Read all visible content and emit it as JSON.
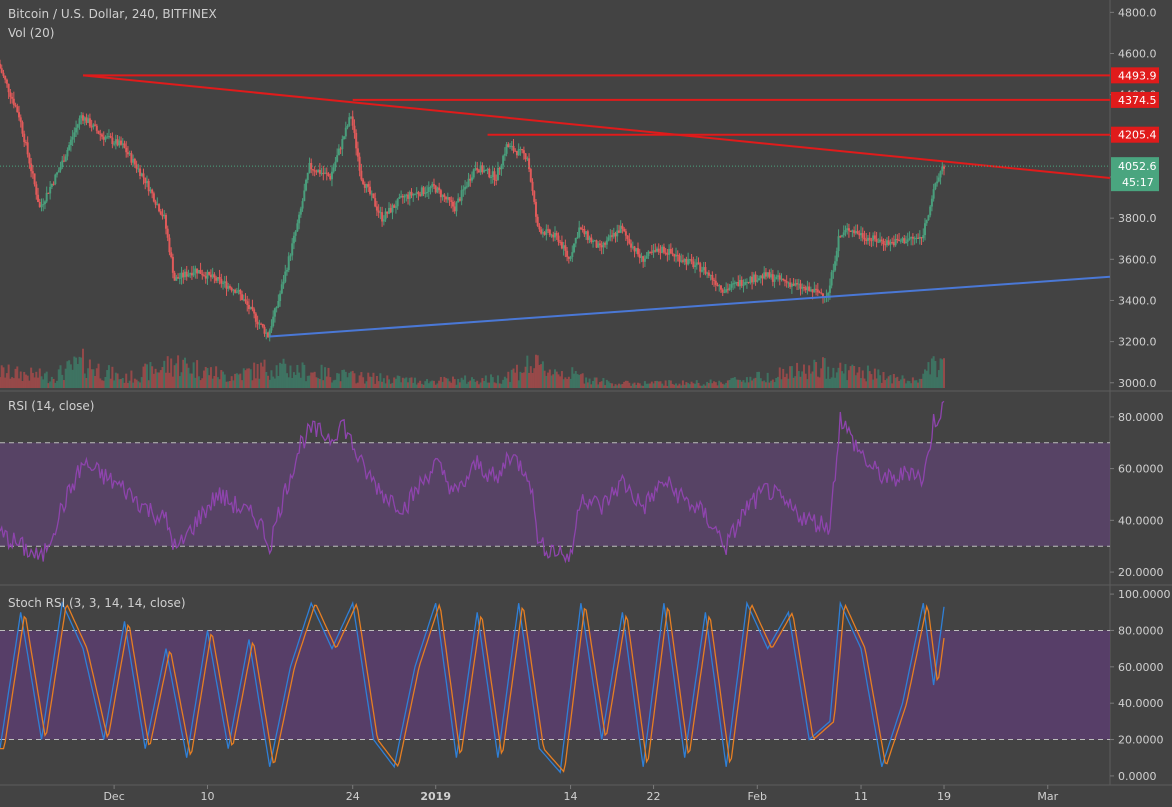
{
  "chart_data": [
    {
      "type": "candlestick",
      "title": "Bitcoin / U.S. Dollar, 240, BITFINEX",
      "volume_label": "Vol (20)",
      "ylim": [
        2960,
        4860
      ],
      "y_ticks": [
        "4800.0",
        "4600.0",
        "4400.0",
        "4200.0",
        "4000.0",
        "3800.0",
        "3600.0",
        "3400.0",
        "3200.0",
        "3000.0"
      ],
      "x_ticks": [
        "Dec",
        "10",
        "24",
        "2019",
        "14",
        "22",
        "Feb",
        "11",
        "19",
        "Mar"
      ],
      "x_start": "2018-11-20",
      "x_end": "2019-03-07",
      "last_price": "4052.6",
      "countdown": "45:17",
      "price_levels": [
        {
          "label": "4493.9",
          "value": 4493.9,
          "from": "2018-11-28"
        },
        {
          "label": "4374.5",
          "value": 4374.5,
          "from": "2018-12-24"
        },
        {
          "label": "4205.4",
          "value": 4205.4,
          "from": "2019-01-06"
        }
      ],
      "trendlines": [
        {
          "name": "resistance",
          "from": {
            "date": "2018-11-28",
            "price": 4493.9
          },
          "to": {
            "date": "2019-03-07",
            "price": 3995
          }
        },
        {
          "name": "support",
          "from": {
            "date": "2018-12-16",
            "price": 3225
          },
          "to": {
            "date": "2019-03-07",
            "price": 3515
          }
        }
      ],
      "price_path": [
        [
          "2018-11-20",
          4550
        ],
        [
          "2018-11-22",
          4300
        ],
        [
          "2018-11-24",
          3850
        ],
        [
          "2018-11-26",
          4050
        ],
        [
          "2018-11-28",
          4300
        ],
        [
          "2018-11-30",
          4200
        ],
        [
          "2018-12-02",
          4150
        ],
        [
          "2018-12-04",
          4000
        ],
        [
          "2018-12-06",
          3800
        ],
        [
          "2018-12-07",
          3500
        ],
        [
          "2018-12-09",
          3550
        ],
        [
          "2018-12-11",
          3500
        ],
        [
          "2018-12-13",
          3450
        ],
        [
          "2018-12-15",
          3300
        ],
        [
          "2018-12-16",
          3230
        ],
        [
          "2018-12-17",
          3400
        ],
        [
          "2018-12-19",
          3800
        ],
        [
          "2018-12-20",
          4050
        ],
        [
          "2018-12-22",
          4000
        ],
        [
          "2018-12-24",
          4300
        ],
        [
          "2018-12-25",
          4000
        ],
        [
          "2018-12-27",
          3800
        ],
        [
          "2018-12-29",
          3900
        ],
        [
          "2019-01-01",
          3950
        ],
        [
          "2019-01-03",
          3850
        ],
        [
          "2019-01-05",
          4050
        ],
        [
          "2019-01-07",
          4000
        ],
        [
          "2019-01-08",
          4150
        ],
        [
          "2019-01-10",
          4100
        ],
        [
          "2019-01-11",
          3750
        ],
        [
          "2019-01-13",
          3700
        ],
        [
          "2019-01-14",
          3600
        ],
        [
          "2019-01-15",
          3750
        ],
        [
          "2019-01-17",
          3650
        ],
        [
          "2019-01-19",
          3750
        ],
        [
          "2019-01-21",
          3600
        ],
        [
          "2019-01-23",
          3650
        ],
        [
          "2019-01-25",
          3600
        ],
        [
          "2019-01-27",
          3550
        ],
        [
          "2019-01-29",
          3450
        ],
        [
          "2019-01-31",
          3500
        ],
        [
          "2019-02-02",
          3520
        ],
        [
          "2019-02-04",
          3490
        ],
        [
          "2019-02-06",
          3450
        ],
        [
          "2019-02-08",
          3430
        ],
        [
          "2019-02-09",
          3700
        ],
        [
          "2019-02-10",
          3750
        ],
        [
          "2019-02-12",
          3700
        ],
        [
          "2019-02-14",
          3680
        ],
        [
          "2019-02-16",
          3700
        ],
        [
          "2019-02-17",
          3700
        ],
        [
          "2019-02-18",
          3900
        ],
        [
          "2019-02-19",
          4052.6
        ]
      ],
      "volume_path": [
        [
          "2018-11-20",
          0.35
        ],
        [
          "2018-11-25",
          0.25
        ],
        [
          "2018-11-28",
          0.55
        ],
        [
          "2018-12-02",
          0.2
        ],
        [
          "2018-12-07",
          0.55
        ],
        [
          "2018-12-12",
          0.25
        ],
        [
          "2018-12-16",
          0.45
        ],
        [
          "2018-12-20",
          0.35
        ],
        [
          "2018-12-24",
          0.25
        ],
        [
          "2018-12-31",
          0.15
        ],
        [
          "2019-01-07",
          0.2
        ],
        [
          "2019-01-10",
          0.5
        ],
        [
          "2019-01-18",
          0.1
        ],
        [
          "2019-01-28",
          0.12
        ],
        [
          "2019-02-08",
          0.45
        ],
        [
          "2019-02-16",
          0.15
        ],
        [
          "2019-02-19",
          0.6
        ]
      ]
    },
    {
      "type": "line",
      "title": "RSI (14, close)",
      "ylim": [
        15,
        90
      ],
      "y_ticks": [
        "80.0000",
        "60.0000",
        "40.0000",
        "20.0000"
      ],
      "band": [
        30,
        70
      ],
      "series": [
        {
          "color": "#8e44ad",
          "points": [
            [
              "2018-11-20",
              35
            ],
            [
              "2018-11-22",
              30
            ],
            [
              "2018-11-24",
              25
            ],
            [
              "2018-11-26",
              45
            ],
            [
              "2018-11-28",
              62
            ],
            [
              "2018-11-30",
              57
            ],
            [
              "2018-12-02",
              52
            ],
            [
              "2018-12-04",
              45
            ],
            [
              "2018-12-06",
              40
            ],
            [
              "2018-12-07",
              28
            ],
            [
              "2018-12-09",
              40
            ],
            [
              "2018-12-11",
              50
            ],
            [
              "2018-12-13",
              45
            ],
            [
              "2018-12-15",
              40
            ],
            [
              "2018-12-16",
              30
            ],
            [
              "2018-12-17",
              45
            ],
            [
              "2018-12-19",
              70
            ],
            [
              "2018-12-20",
              75
            ],
            [
              "2018-12-22",
              72
            ],
            [
              "2018-12-23",
              78
            ],
            [
              "2018-12-25",
              60
            ],
            [
              "2018-12-27",
              50
            ],
            [
              "2018-12-29",
              45
            ],
            [
              "2019-01-01",
              62
            ],
            [
              "2019-01-03",
              50
            ],
            [
              "2019-01-05",
              62
            ],
            [
              "2019-01-07",
              55
            ],
            [
              "2019-01-08",
              66
            ],
            [
              "2019-01-10",
              58
            ],
            [
              "2019-01-11",
              30
            ],
            [
              "2019-01-13",
              28
            ],
            [
              "2019-01-14",
              25
            ],
            [
              "2019-01-15",
              50
            ],
            [
              "2019-01-17",
              45
            ],
            [
              "2019-01-19",
              55
            ],
            [
              "2019-01-21",
              45
            ],
            [
              "2019-01-23",
              55
            ],
            [
              "2019-01-25",
              48
            ],
            [
              "2019-01-27",
              42
            ],
            [
              "2019-01-29",
              30
            ],
            [
              "2019-01-31",
              45
            ],
            [
              "2019-02-02",
              52
            ],
            [
              "2019-02-04",
              45
            ],
            [
              "2019-02-06",
              40
            ],
            [
              "2019-02-08",
              38
            ],
            [
              "2019-02-09",
              80
            ],
            [
              "2019-02-10",
              72
            ],
            [
              "2019-02-12",
              60
            ],
            [
              "2019-02-14",
              55
            ],
            [
              "2019-02-16",
              60
            ],
            [
              "2019-02-17",
              55
            ],
            [
              "2019-02-18",
              78
            ],
            [
              "2019-02-19",
              84
            ]
          ]
        }
      ]
    },
    {
      "type": "line",
      "title": "Stoch RSI (3, 3, 14, 14, close)",
      "ylim": [
        -5,
        105
      ],
      "y_ticks": [
        "100.0000",
        "80.0000",
        "60.0000",
        "40.0000",
        "20.0000",
        "0.0000"
      ],
      "band": [
        20,
        80
      ],
      "series": [
        {
          "color": "#2f7fd6",
          "offset_days": 0,
          "points": [
            [
              "2018-11-20",
              15
            ],
            [
              "2018-11-22",
              90
            ],
            [
              "2018-11-24",
              20
            ],
            [
              "2018-11-26",
              95
            ],
            [
              "2018-11-28",
              70
            ],
            [
              "2018-11-30",
              20
            ],
            [
              "2018-12-02",
              85
            ],
            [
              "2018-12-04",
              15
            ],
            [
              "2018-12-06",
              70
            ],
            [
              "2018-12-08",
              10
            ],
            [
              "2018-12-10",
              80
            ],
            [
              "2018-12-12",
              15
            ],
            [
              "2018-12-14",
              75
            ],
            [
              "2018-12-16",
              5
            ],
            [
              "2018-12-18",
              60
            ],
            [
              "2018-12-20",
              95
            ],
            [
              "2018-12-22",
              70
            ],
            [
              "2018-12-24",
              95
            ],
            [
              "2018-12-26",
              20
            ],
            [
              "2018-12-28",
              5
            ],
            [
              "2018-12-30",
              60
            ],
            [
              "2019-01-01",
              95
            ],
            [
              "2019-01-03",
              10
            ],
            [
              "2019-01-05",
              90
            ],
            [
              "2019-01-07",
              10
            ],
            [
              "2019-01-09",
              95
            ],
            [
              "2019-01-11",
              15
            ],
            [
              "2019-01-13",
              2
            ],
            [
              "2019-01-15",
              95
            ],
            [
              "2019-01-17",
              20
            ],
            [
              "2019-01-19",
              90
            ],
            [
              "2019-01-21",
              5
            ],
            [
              "2019-01-23",
              95
            ],
            [
              "2019-01-25",
              10
            ],
            [
              "2019-01-27",
              90
            ],
            [
              "2019-01-29",
              5
            ],
            [
              "2019-01-31",
              95
            ],
            [
              "2019-02-02",
              70
            ],
            [
              "2019-02-04",
              90
            ],
            [
              "2019-02-06",
              20
            ],
            [
              "2019-02-08",
              30
            ],
            [
              "2019-02-09",
              95
            ],
            [
              "2019-02-11",
              70
            ],
            [
              "2019-02-13",
              5
            ],
            [
              "2019-02-15",
              40
            ],
            [
              "2019-02-17",
              95
            ],
            [
              "2019-02-18",
              50
            ],
            [
              "2019-02-19",
              93
            ]
          ]
        },
        {
          "color": "#e67e22",
          "offset_days": 0.4,
          "points": [
            [
              "2018-11-20",
              15
            ],
            [
              "2018-11-22",
              90
            ],
            [
              "2018-11-24",
              20
            ],
            [
              "2018-11-26",
              95
            ],
            [
              "2018-11-28",
              70
            ],
            [
              "2018-11-30",
              20
            ],
            [
              "2018-12-02",
              85
            ],
            [
              "2018-12-04",
              15
            ],
            [
              "2018-12-06",
              70
            ],
            [
              "2018-12-08",
              10
            ],
            [
              "2018-12-10",
              80
            ],
            [
              "2018-12-12",
              15
            ],
            [
              "2018-12-14",
              75
            ],
            [
              "2018-12-16",
              5
            ],
            [
              "2018-12-18",
              60
            ],
            [
              "2018-12-20",
              95
            ],
            [
              "2018-12-22",
              70
            ],
            [
              "2018-12-24",
              95
            ],
            [
              "2018-12-26",
              20
            ],
            [
              "2018-12-28",
              5
            ],
            [
              "2018-12-30",
              60
            ],
            [
              "2019-01-01",
              95
            ],
            [
              "2019-01-03",
              10
            ],
            [
              "2019-01-05",
              90
            ],
            [
              "2019-01-07",
              10
            ],
            [
              "2019-01-09",
              95
            ],
            [
              "2019-01-11",
              15
            ],
            [
              "2019-01-13",
              2
            ],
            [
              "2019-01-15",
              95
            ],
            [
              "2019-01-17",
              20
            ],
            [
              "2019-01-19",
              90
            ],
            [
              "2019-01-21",
              5
            ],
            [
              "2019-01-23",
              95
            ],
            [
              "2019-01-25",
              10
            ],
            [
              "2019-01-27",
              90
            ],
            [
              "2019-01-29",
              5
            ],
            [
              "2019-01-31",
              95
            ],
            [
              "2019-02-02",
              70
            ],
            [
              "2019-02-04",
              90
            ],
            [
              "2019-02-06",
              20
            ],
            [
              "2019-02-08",
              30
            ],
            [
              "2019-02-09",
              95
            ],
            [
              "2019-02-11",
              70
            ],
            [
              "2019-02-13",
              5
            ],
            [
              "2019-02-15",
              40
            ],
            [
              "2019-02-17",
              95
            ],
            [
              "2019-02-18",
              50
            ],
            [
              "2019-02-19",
              93
            ]
          ]
        }
      ]
    }
  ],
  "colors": {
    "background": "#434343",
    "up": "#4a9e7c",
    "down": "#e05a5a",
    "level": "#e01b1b",
    "support": "#4a78d6",
    "band_fill": "#5d4370",
    "stoch_fill": "#5a3d6e",
    "axis_text": "#d0d0d0",
    "last_price_bg": "#4aa57f"
  }
}
